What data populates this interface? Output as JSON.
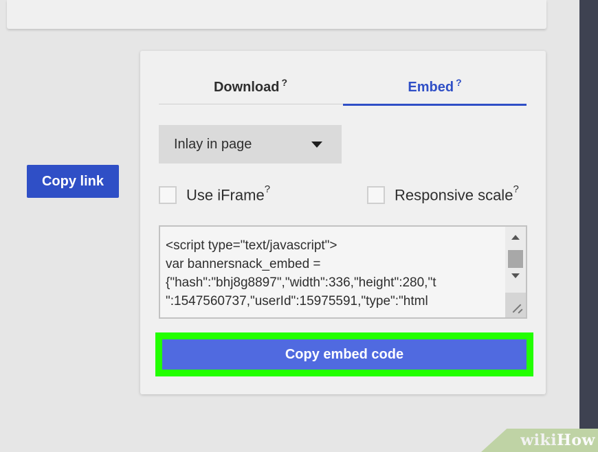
{
  "top_card": {},
  "sidebar": {
    "copy_link_label": "Copy link"
  },
  "tabs": [
    {
      "label": "Download",
      "help": "?",
      "active": false
    },
    {
      "label": "Embed",
      "help": "?",
      "active": true
    }
  ],
  "dropdown": {
    "selected": "Inlay in page"
  },
  "options": {
    "iframe_label": "Use iFrame",
    "iframe_help": "?",
    "iframe_checked": false,
    "responsive_label": "Responsive scale",
    "responsive_help": "?",
    "responsive_checked": false
  },
  "code": {
    "text": "<script type=\"text/javascript\">\nvar bannersnack_embed =\n{\"hash\":\"bhj8g8897\",\"width\":336,\"height\":280,\"t\n\":1547560737,\"userId\":15975591,\"type\":\"html"
  },
  "actions": {
    "copy_embed_label": "Copy embed code"
  },
  "watermark": {
    "wiki": "wiki",
    "how": "How"
  },
  "colors": {
    "accent": "#2f4fc6",
    "button": "#506ae0",
    "highlight": "#22ff00",
    "dark_bar": "#3e4251"
  }
}
